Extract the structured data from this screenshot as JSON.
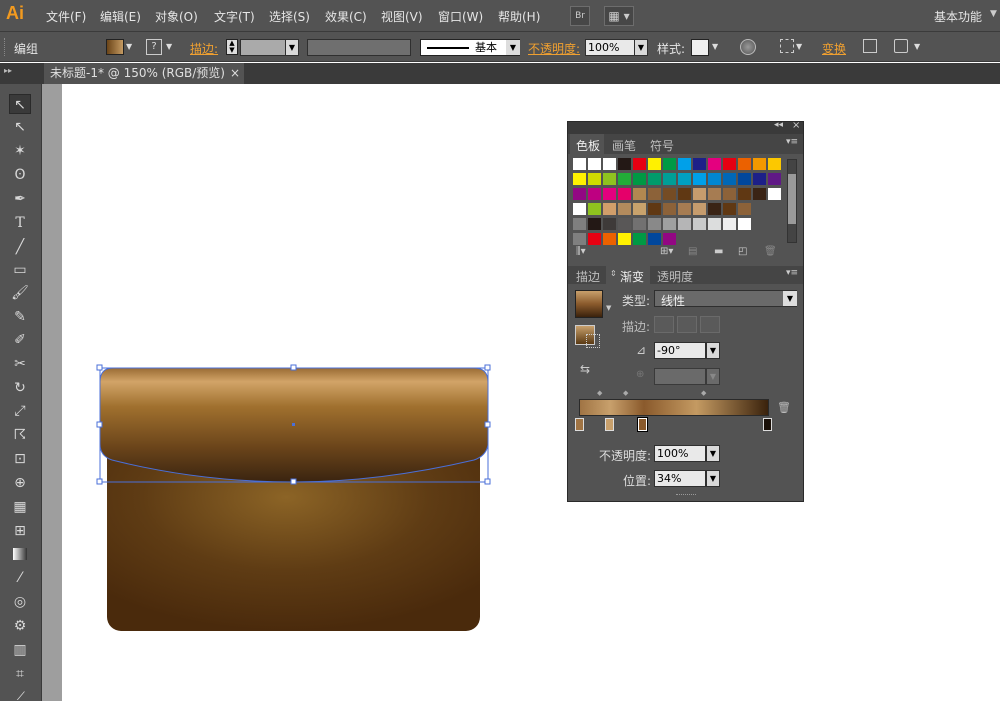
{
  "app": {
    "logo": "Ai",
    "workspace": "基本功能"
  },
  "menu": [
    "文件(F)",
    "编辑(E)",
    "对象(O)",
    "文字(T)",
    "选择(S)",
    "效果(C)",
    "视图(V)",
    "窗口(W)",
    "帮助(H)"
  ],
  "menu_buttons": {
    "bridge": "Br",
    "arrange": "▦"
  },
  "control": {
    "selection": "编组",
    "stroke_label": "描边:",
    "profile_value": "基本",
    "opacity_label": "不透明度:",
    "opacity_value": "100%",
    "style_label": "样式:",
    "transform_label": "变换"
  },
  "document_tab": {
    "title": "未标题-1* @ 150% (RGB/预览)",
    "close": "×"
  },
  "swatch_panel": {
    "tabs": [
      "色板",
      "画笔",
      "符号"
    ],
    "rows": [
      [
        "#ffffff",
        "#ffffff",
        "#ffffff",
        "#231815",
        "#e60012",
        "#fff100",
        "#009944",
        "#00a0e9",
        "#1d2088",
        "#e4007f",
        "#e60012",
        "#eb6100",
        "#f39800",
        "#fcc800"
      ],
      [
        "#fff100",
        "#cfdb00",
        "#8fc31f",
        "#22ac38",
        "#009944",
        "#009b6b",
        "#009e96",
        "#00a0c1",
        "#00a0e9",
        "#0086d1",
        "#0068b7",
        "#00479d",
        "#1d2088",
        "#601986"
      ],
      [
        "#920783",
        "#be0081",
        "#e4007f",
        "#e5006a",
        "#b28850",
        "#8c6239",
        "#754c24",
        "#603813",
        "#c69c6d",
        "#a67c52",
        "#8c6239",
        "#603813",
        "#3a2415",
        "#ffffff"
      ],
      [
        "#ffffff",
        "#8fc31f",
        "#d19e6a",
        "#b38b5d",
        "#c8a26c",
        "#603813",
        "#8c6239",
        "#a67c52",
        "#c69c6d",
        "#3a2415",
        "#603813",
        "#8c6239"
      ],
      [
        "#7f7f7f",
        "#231815",
        "#3e3a39",
        "#595757",
        "#727171",
        "#898989",
        "#9fa0a0",
        "#b5b5b6",
        "#c9caca",
        "#dcdddd",
        "#efefef",
        "#ffffff"
      ],
      [
        "#7f7f7f",
        "#e60012",
        "#eb6100",
        "#fff100",
        "#009944",
        "#00479d",
        "#920783"
      ]
    ]
  },
  "gradient_panel": {
    "tabs": [
      "描边",
      "渐变",
      "透明度"
    ],
    "type_label": "类型:",
    "type_value": "线性",
    "stroke_label": "描边:",
    "angle_value": "-90°",
    "opacity_label": "不透明度:",
    "opacity_value": "100%",
    "location_label": "位置:",
    "location_value": "34%"
  },
  "colors": {
    "ui_bg": "#535353",
    "accent": "#f0a030",
    "selection": "#4a6fd8",
    "gradient_stops": [
      "#a07444",
      "#c8a06c",
      "#8a5a2c",
      "#3a220c"
    ]
  },
  "artwork": {
    "flap_gradient": [
      "#d2a468",
      "#a0702e",
      "#6a441a",
      "#3a2410"
    ],
    "body_gradient_center": "#8c6426",
    "body_gradient_edge": "#4a2a0c"
  }
}
